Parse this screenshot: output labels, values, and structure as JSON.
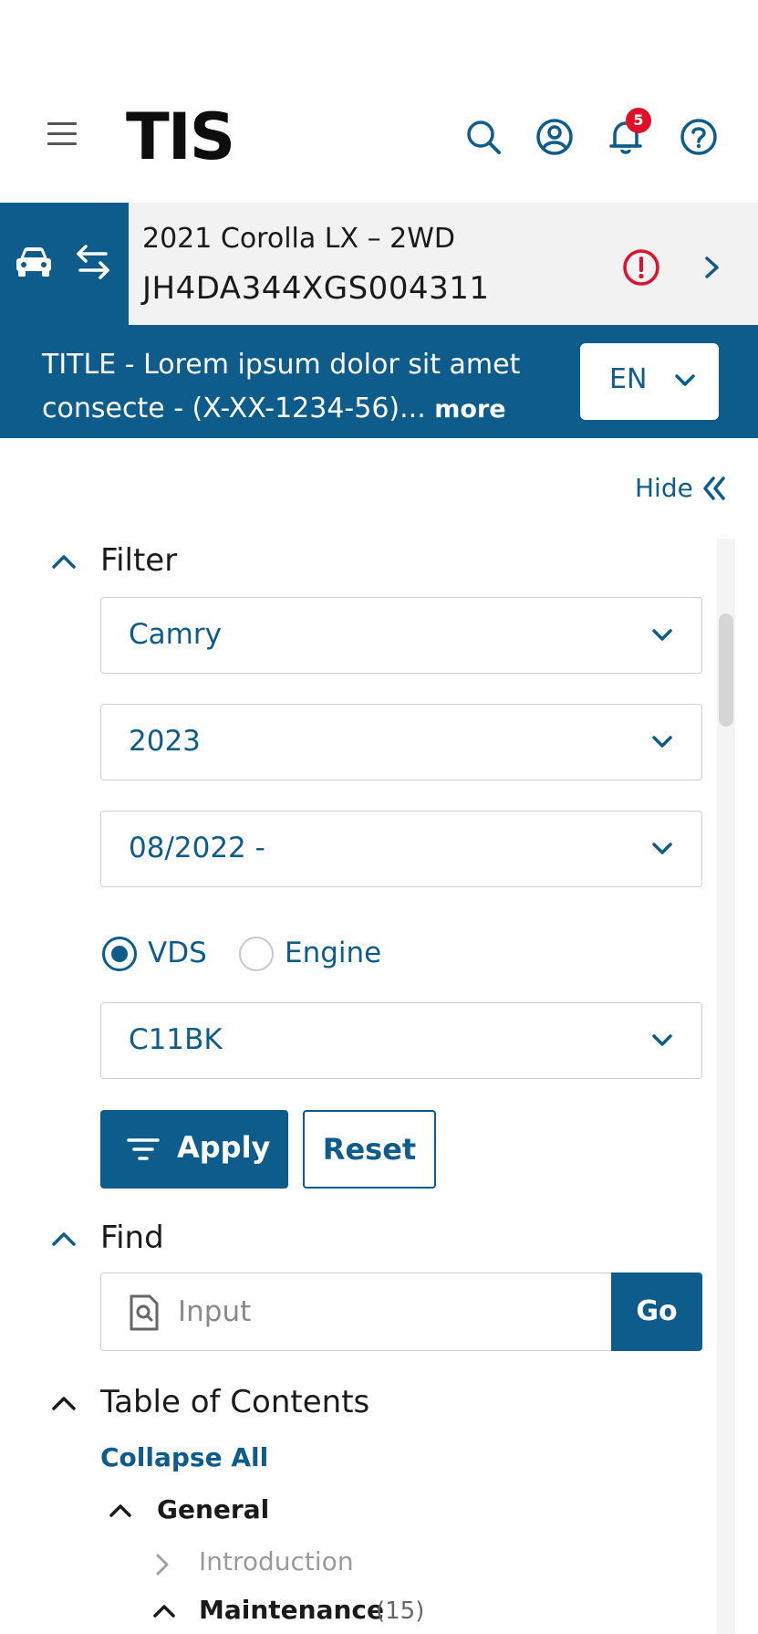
{
  "header": {
    "logo": "TIS",
    "notification_count": "5"
  },
  "vehicle": {
    "model": "2021 Corolla LX – 2WD",
    "vin": "JH4DA344XGS004311"
  },
  "document": {
    "title": "TITLE - Lorem ipsum dolor sit amet consecte - (X-XX-1234-56)...",
    "more_label": "more",
    "language": "EN"
  },
  "panel": {
    "hide_label": "Hide"
  },
  "filter": {
    "heading": "Filter",
    "model_value": "Camry",
    "year_value": "2023",
    "date_value": "08/2022 -",
    "radio_vds_label": "VDS",
    "radio_engine_label": "Engine",
    "radio_selected": "VDS",
    "code_value": "C11BK",
    "apply_label": "Apply",
    "reset_label": "Reset"
  },
  "find": {
    "heading": "Find",
    "placeholder": "Input",
    "go_label": "Go"
  },
  "toc": {
    "heading": "Table of Contents",
    "collapse_all_label": "Collapse All",
    "items": [
      {
        "label": "General",
        "state": "expanded"
      },
      {
        "label": "Introduction",
        "state": "collapsed"
      },
      {
        "label": "Maintenance",
        "count": "(15)",
        "state": "expanded"
      }
    ]
  },
  "colors": {
    "brand_blue": "#0d5c8c",
    "alert_red": "#e0102a",
    "vehicle_bar_bg": "#f2f2f2"
  },
  "icons": {
    "menu": "hamburger-icon",
    "search": "search-icon",
    "account": "account-icon",
    "notifications": "bell-icon",
    "help": "help-icon",
    "vehicle": "car-icon",
    "swap": "swap-arrows-icon",
    "alert": "alert-circle-icon"
  }
}
